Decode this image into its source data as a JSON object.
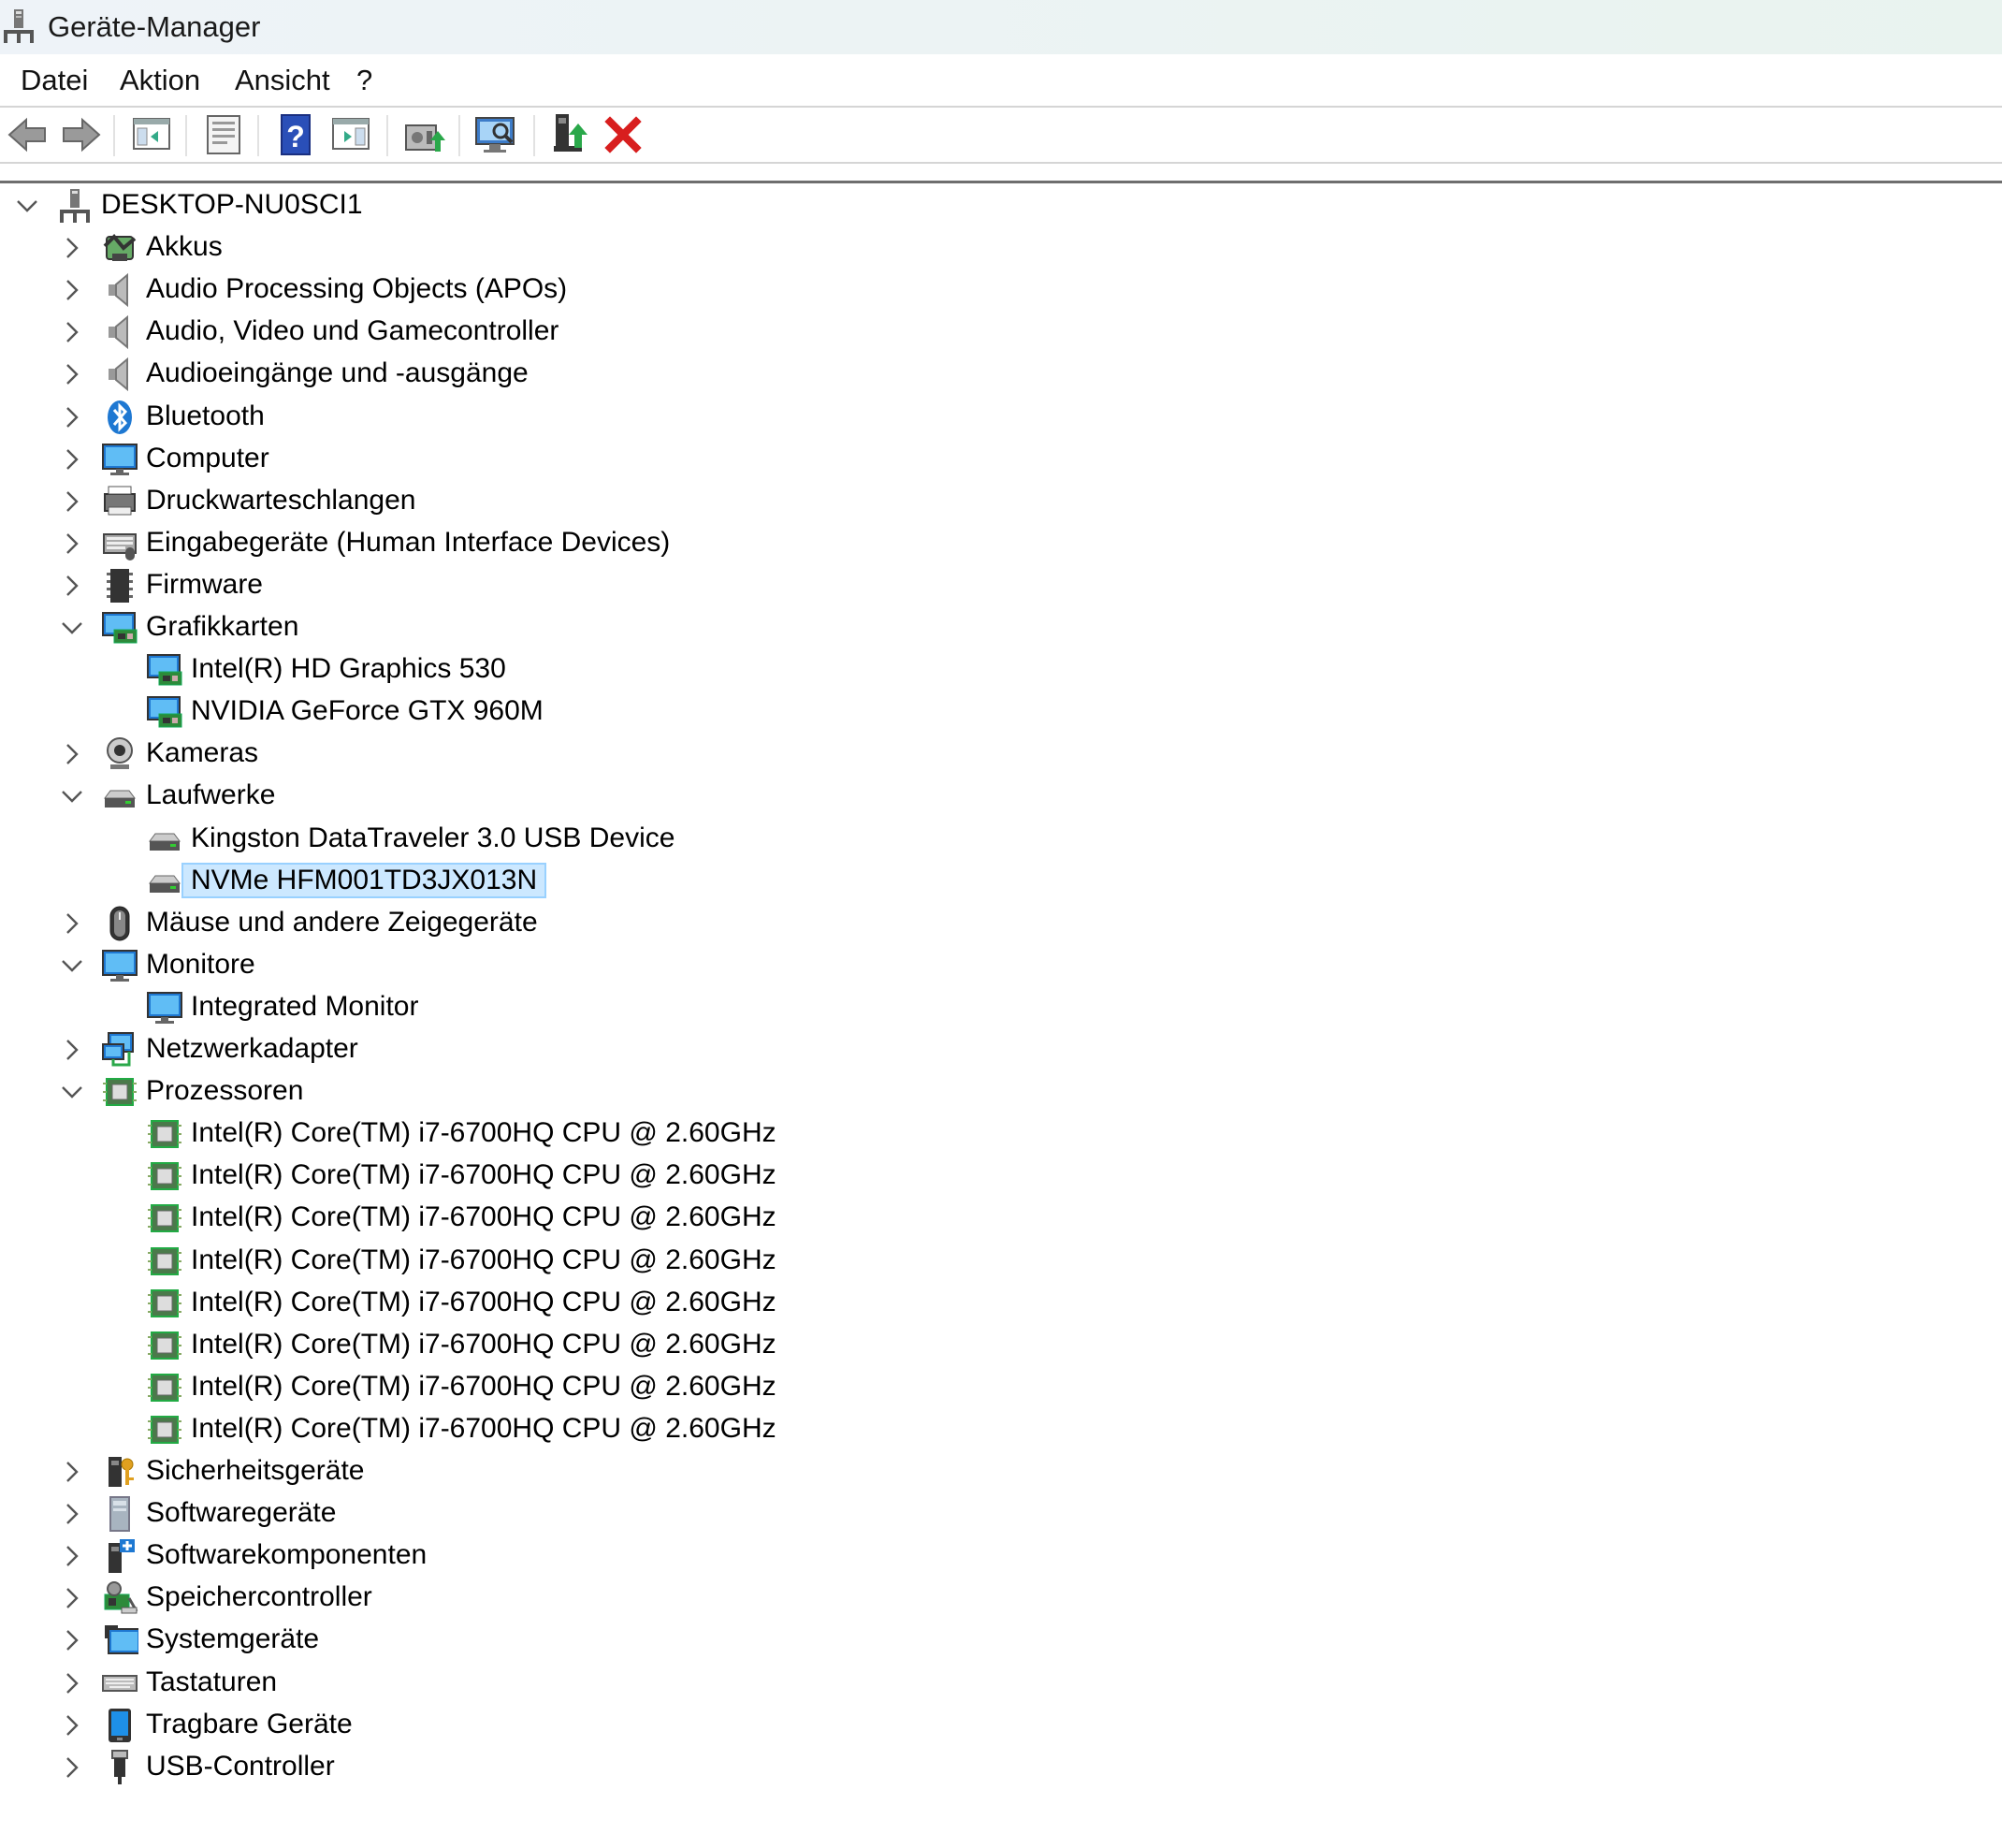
{
  "window": {
    "title": "Geräte-Manager",
    "icon": "device-manager-icon"
  },
  "menu": [
    "Datei",
    "Aktion",
    "Ansicht",
    "?"
  ],
  "toolbar": [
    {
      "name": "back-button",
      "icon": "arrow-left-icon"
    },
    {
      "name": "forward-button",
      "icon": "arrow-right-icon"
    },
    {
      "name": "show-hide-console-tree-button",
      "icon": "console-tree-icon"
    },
    {
      "name": "properties-button",
      "icon": "properties-icon"
    },
    {
      "name": "help-button",
      "icon": "help-icon"
    },
    {
      "name": "show-hide-action-pane-button",
      "icon": "action-pane-icon"
    },
    {
      "name": "update-driver-button",
      "icon": "update-driver-icon"
    },
    {
      "name": "scan-hardware-changes-button",
      "icon": "scan-hardware-icon"
    },
    {
      "name": "enable-device-button",
      "icon": "enable-device-icon"
    },
    {
      "name": "uninstall-device-button",
      "icon": "uninstall-icon"
    }
  ],
  "tree": [
    {
      "level": 0,
      "state": "expanded",
      "icon": "computer-root",
      "label": "DESKTOP-NU0SCI1"
    },
    {
      "level": 1,
      "state": "collapsed",
      "icon": "battery",
      "label": "Akkus"
    },
    {
      "level": 1,
      "state": "collapsed",
      "icon": "speaker",
      "label": "Audio Processing Objects (APOs)"
    },
    {
      "level": 1,
      "state": "collapsed",
      "icon": "speaker",
      "label": "Audio, Video und Gamecontroller"
    },
    {
      "level": 1,
      "state": "collapsed",
      "icon": "speaker",
      "label": "Audioeingänge und -ausgänge"
    },
    {
      "level": 1,
      "state": "collapsed",
      "icon": "bluetooth",
      "label": "Bluetooth"
    },
    {
      "level": 1,
      "state": "collapsed",
      "icon": "monitor",
      "label": "Computer"
    },
    {
      "level": 1,
      "state": "collapsed",
      "icon": "printer",
      "label": "Druckwarteschlangen"
    },
    {
      "level": 1,
      "state": "collapsed",
      "icon": "hid",
      "label": "Eingabegeräte (Human Interface Devices)"
    },
    {
      "level": 1,
      "state": "collapsed",
      "icon": "firmware",
      "label": "Firmware"
    },
    {
      "level": 1,
      "state": "expanded",
      "icon": "display-adapter",
      "label": "Grafikkarten"
    },
    {
      "level": 2,
      "state": "leaf",
      "icon": "display-adapter",
      "label": "Intel(R) HD Graphics 530"
    },
    {
      "level": 2,
      "state": "leaf",
      "icon": "display-adapter",
      "label": "NVIDIA GeForce GTX 960M"
    },
    {
      "level": 1,
      "state": "collapsed",
      "icon": "camera",
      "label": "Kameras"
    },
    {
      "level": 1,
      "state": "expanded",
      "icon": "drive",
      "label": "Laufwerke"
    },
    {
      "level": 2,
      "state": "leaf",
      "icon": "drive",
      "label": "Kingston DataTraveler 3.0 USB Device"
    },
    {
      "level": 2,
      "state": "leaf",
      "icon": "drive",
      "label": "NVMe HFM001TD3JX013N",
      "selected": true
    },
    {
      "level": 1,
      "state": "collapsed",
      "icon": "mouse",
      "label": "Mäuse und andere Zeigegeräte"
    },
    {
      "level": 1,
      "state": "expanded",
      "icon": "monitor",
      "label": "Monitore"
    },
    {
      "level": 2,
      "state": "leaf",
      "icon": "monitor",
      "label": "Integrated Monitor"
    },
    {
      "level": 1,
      "state": "collapsed",
      "icon": "network",
      "label": "Netzwerkadapter"
    },
    {
      "level": 1,
      "state": "expanded",
      "icon": "cpu",
      "label": "Prozessoren"
    },
    {
      "level": 2,
      "state": "leaf",
      "icon": "cpu",
      "label": "Intel(R) Core(TM) i7-6700HQ CPU @ 2.60GHz"
    },
    {
      "level": 2,
      "state": "leaf",
      "icon": "cpu",
      "label": "Intel(R) Core(TM) i7-6700HQ CPU @ 2.60GHz"
    },
    {
      "level": 2,
      "state": "leaf",
      "icon": "cpu",
      "label": "Intel(R) Core(TM) i7-6700HQ CPU @ 2.60GHz"
    },
    {
      "level": 2,
      "state": "leaf",
      "icon": "cpu",
      "label": "Intel(R) Core(TM) i7-6700HQ CPU @ 2.60GHz"
    },
    {
      "level": 2,
      "state": "leaf",
      "icon": "cpu",
      "label": "Intel(R) Core(TM) i7-6700HQ CPU @ 2.60GHz"
    },
    {
      "level": 2,
      "state": "leaf",
      "icon": "cpu",
      "label": "Intel(R) Core(TM) i7-6700HQ CPU @ 2.60GHz"
    },
    {
      "level": 2,
      "state": "leaf",
      "icon": "cpu",
      "label": "Intel(R) Core(TM) i7-6700HQ CPU @ 2.60GHz"
    },
    {
      "level": 2,
      "state": "leaf",
      "icon": "cpu",
      "label": "Intel(R) Core(TM) i7-6700HQ CPU @ 2.60GHz"
    },
    {
      "level": 1,
      "state": "collapsed",
      "icon": "security",
      "label": "Sicherheitsgeräte"
    },
    {
      "level": 1,
      "state": "collapsed",
      "icon": "software-device",
      "label": "Softwaregeräte"
    },
    {
      "level": 1,
      "state": "collapsed",
      "icon": "software-component",
      "label": "Softwarekomponenten"
    },
    {
      "level": 1,
      "state": "collapsed",
      "icon": "storage-controller",
      "label": "Speichercontroller"
    },
    {
      "level": 1,
      "state": "collapsed",
      "icon": "system-device",
      "label": "Systemgeräte"
    },
    {
      "level": 1,
      "state": "collapsed",
      "icon": "keyboard",
      "label": "Tastaturen"
    },
    {
      "level": 1,
      "state": "collapsed",
      "icon": "portable",
      "label": "Tragbare Geräte"
    },
    {
      "level": 1,
      "state": "collapsed",
      "icon": "usb",
      "label": "USB-Controller"
    }
  ],
  "colors": {
    "selection": "#cce8ff",
    "selection_border": "#99d1ff",
    "accent_blue": "#1e78d2",
    "delete_red": "#d81e1e"
  }
}
